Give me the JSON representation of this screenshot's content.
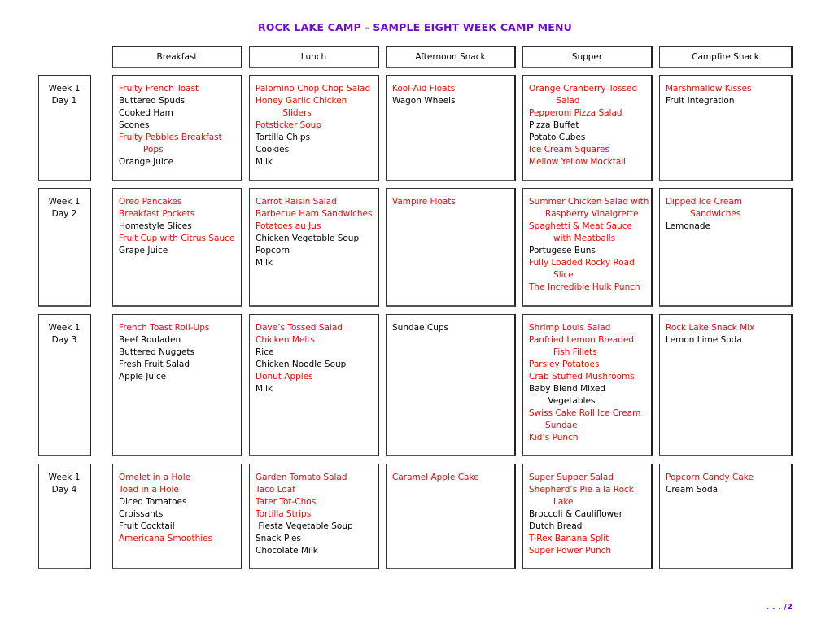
{
  "title": "ROCK LAKE CAMP - SAMPLE EIGHT WEEK CAMP MENU",
  "colors": {
    "title": "#6a0dd1",
    "highlight": "#ff0000",
    "normal": "#000000"
  },
  "columns": [
    "Breakfast",
    "Lunch",
    "Afternoon Snack",
    "Supper",
    "Campfire Snack"
  ],
  "rows": [
    {
      "week": "Week 1",
      "day": "Day 1",
      "cells": [
        [
          {
            "t": "Fruity French Toast",
            "hl": true
          },
          {
            "t": "Buttered Spuds",
            "hl": false
          },
          {
            "t": "Cooked Ham",
            "hl": false
          },
          {
            "t": "Scones",
            "hl": false
          },
          {
            "t": "Fruity Pebbles Breakfast",
            "hl": true
          },
          {
            "t": "         Pops",
            "hl": true
          },
          {
            "t": "Orange Juice",
            "hl": false
          }
        ],
        [
          {
            "t": "Palomino Chop Chop Salad",
            "hl": true
          },
          {
            "t": "Honey Garlic Chicken",
            "hl": true
          },
          {
            "t": "          Sliders",
            "hl": true
          },
          {
            "t": "Potsticker Soup",
            "hl": true
          },
          {
            "t": "Tortilla Chips",
            "hl": false
          },
          {
            "t": "Cookies",
            "hl": false
          },
          {
            "t": "Milk",
            "hl": false
          }
        ],
        [
          {
            "t": "Kool-Aid Floats",
            "hl": true
          },
          {
            "t": "Wagon Wheels",
            "hl": false
          }
        ],
        [
          {
            "t": "Orange Cranberry Tossed",
            "hl": true
          },
          {
            "t": "          Salad",
            "hl": true
          },
          {
            "t": "Pepperoni Pizza Salad",
            "hl": true
          },
          {
            "t": "Pizza Buffet",
            "hl": false
          },
          {
            "t": "Potato Cubes",
            "hl": false
          },
          {
            "t": "Ice Cream Squares",
            "hl": true
          },
          {
            "t": "Mellow Yellow Mocktail",
            "hl": true
          }
        ],
        [
          {
            "t": "Marshmallow Kisses",
            "hl": true
          },
          {
            "t": "Fruit Integration",
            "hl": false
          }
        ]
      ]
    },
    {
      "week": "Week 1",
      "day": "Day 2",
      "cells": [
        [
          {
            "t": "Oreo Pancakes",
            "hl": true
          },
          {
            "t": "Breakfast Pockets",
            "hl": true
          },
          {
            "t": "Homestyle Slices",
            "hl": false
          },
          {
            "t": "Fruit Cup with Citrus Sauce",
            "hl": true
          },
          {
            "t": "Grape Juice",
            "hl": false
          }
        ],
        [
          {
            "t": "Carrot Raisin Salad",
            "hl": true
          },
          {
            "t": "Barbecue Ham Sandwiches",
            "hl": true
          },
          {
            "t": "Potatoes au Jus",
            "hl": true
          },
          {
            "t": "Chicken Vegetable Soup",
            "hl": false
          },
          {
            "t": "Popcorn",
            "hl": false
          },
          {
            "t": "Milk",
            "hl": false
          }
        ],
        [
          {
            "t": "Vampire Floats",
            "hl": true
          }
        ],
        [
          {
            "t": "Summer Chicken Salad with",
            "hl": true
          },
          {
            "t": "      Raspberry Vinaigrette",
            "hl": true
          },
          {
            "t": "Spaghetti & Meat Sauce",
            "hl": true
          },
          {
            "t": "         with Meatballs",
            "hl": true
          },
          {
            "t": "Portugese Buns",
            "hl": false
          },
          {
            "t": "Fully Loaded Rocky Road",
            "hl": true
          },
          {
            "t": "         Slice",
            "hl": true
          },
          {
            "t": "The Incredible Hulk Punch",
            "hl": true
          }
        ],
        [
          {
            "t": "Dipped Ice Cream",
            "hl": true
          },
          {
            "t": "         Sandwiches",
            "hl": true
          },
          {
            "t": "Lemonade",
            "hl": false
          }
        ]
      ]
    },
    {
      "week": "Week 1",
      "day": "Day 3",
      "cells": [
        [
          {
            "t": "French Toast Roll-Ups",
            "hl": true
          },
          {
            "t": "Beef Rouladen",
            "hl": false
          },
          {
            "t": "Buttered Nuggets",
            "hl": false
          },
          {
            "t": "Fresh Fruit Salad",
            "hl": false
          },
          {
            "t": "Apple Juice",
            "hl": false
          }
        ],
        [
          {
            "t": "Dave’s Tossed Salad",
            "hl": true
          },
          {
            "t": "Chicken Melts",
            "hl": true
          },
          {
            "t": "Rice",
            "hl": false
          },
          {
            "t": "Chicken Noodle Soup",
            "hl": false
          },
          {
            "t": "Donut Apples",
            "hl": true
          },
          {
            "t": "Milk",
            "hl": false
          }
        ],
        [
          {
            "t": "Sundae Cups",
            "hl": false
          }
        ],
        [
          {
            "t": "Shrimp Louis Salad",
            "hl": true
          },
          {
            "t": "Panfried Lemon Breaded",
            "hl": true
          },
          {
            "t": "         Fish Fillets",
            "hl": true
          },
          {
            "t": "Parsley Potatoes",
            "hl": true
          },
          {
            "t": "Crab Stuffed Mushrooms",
            "hl": true
          },
          {
            "t": "Baby Blend Mixed",
            "hl": false
          },
          {
            "t": "       Vegetables",
            "hl": false
          },
          {
            "t": "Swiss Cake Roll Ice Cream",
            "hl": true
          },
          {
            "t": "      Sundae",
            "hl": true
          },
          {
            "t": "Kid’s Punch",
            "hl": true
          }
        ],
        [
          {
            "t": "Rock Lake Snack Mix",
            "hl": true
          },
          {
            "t": "Lemon Lime Soda",
            "hl": false
          }
        ]
      ]
    },
    {
      "week": "Week 1",
      "day": "Day 4",
      "cells": [
        [
          {
            "t": "Omelet in a Hole",
            "hl": true
          },
          {
            "t": "Toad in a Hole",
            "hl": true
          },
          {
            "t": "Diced Tomatoes",
            "hl": false
          },
          {
            "t": "Croissants",
            "hl": false
          },
          {
            "t": "Fruit Cocktail",
            "hl": false
          },
          {
            "t": "Americana Smoothies",
            "hl": true
          }
        ],
        [
          {
            "t": "Garden Tomato Salad",
            "hl": true
          },
          {
            "t": "Taco Loaf",
            "hl": true
          },
          {
            "t": "Tater Tot-Chos",
            "hl": true
          },
          {
            "t": "Tortilla Strips",
            "hl": true
          },
          {
            "t": " Fiesta Vegetable Soup",
            "hl": false
          },
          {
            "t": "Snack Pies",
            "hl": false
          },
          {
            "t": "Chocolate Milk",
            "hl": false
          }
        ],
        [
          {
            "t": "Caramel Apple Cake",
            "hl": true
          }
        ],
        [
          {
            "t": "Super Supper Salad",
            "hl": true
          },
          {
            "t": "Shepherd’s Pie a la Rock",
            "hl": true
          },
          {
            "t": "         Lake",
            "hl": true
          },
          {
            "t": "Broccoli & Cauliflower",
            "hl": false
          },
          {
            "t": "Dutch Bread",
            "hl": false
          },
          {
            "t": "T-Rex Banana Split",
            "hl": true
          },
          {
            "t": "Super Power Punch",
            "hl": true
          }
        ],
        [
          {
            "t": "Popcorn Candy Cake",
            "hl": true
          },
          {
            "t": "Cream Soda",
            "hl": false
          }
        ]
      ]
    }
  ],
  "footer": ". . . /2"
}
